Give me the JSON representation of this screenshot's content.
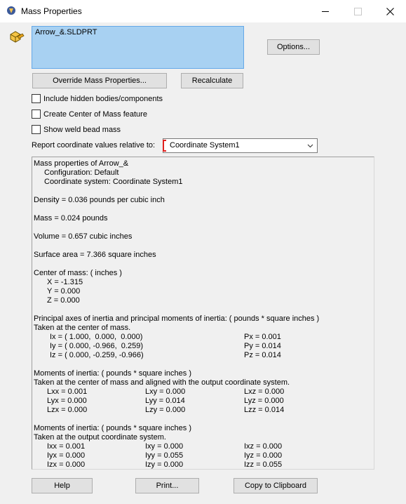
{
  "window": {
    "title": "Mass Properties"
  },
  "selection": {
    "item": "Arrow_&.SLDPRT"
  },
  "buttons": {
    "options": "Options...",
    "override": "Override Mass Properties...",
    "recalculate": "Recalculate",
    "help": "Help",
    "print": "Print...",
    "copy": "Copy to Clipboard"
  },
  "checkboxes": [
    {
      "label": "Include hidden bodies/components",
      "checked": false
    },
    {
      "label": "Create Center of Mass feature",
      "checked": false
    },
    {
      "label": "Show weld bead mass",
      "checked": false
    }
  ],
  "report": {
    "label": "Report coordinate values relative to:",
    "selected": "Coordinate System1"
  },
  "results": {
    "header": "Mass properties of Arrow_&",
    "configuration": "Configuration: Default",
    "coord_system": "Coordinate system: Coordinate System1",
    "density": "Density = 0.036 pounds per cubic inch",
    "mass": "Mass = 0.024 pounds",
    "volume": "Volume = 0.657 cubic inches",
    "surface_area": "Surface area = 7.366 square inches",
    "com_title": "Center of mass: ( inches )",
    "com": [
      "X = -1.315",
      "Y = 0.000",
      "Z = 0.000"
    ],
    "principal_title": "Principal axes of inertia and principal moments of inertia: ( pounds * square inches )",
    "principal_sub": "Taken at the center of mass.",
    "principal_axes": [
      "Ix = ( 1.000,  0.000,  0.000)",
      "Iy = ( 0.000, -0.966,  0.259)",
      "Iz = ( 0.000, -0.259, -0.966)"
    ],
    "principal_moments": [
      "Px = 0.001",
      "Py = 0.014",
      "Pz = 0.014"
    ],
    "moi_com_title": "Moments of inertia: ( pounds * square inches )",
    "moi_com_sub": "Taken at the center of mass and aligned with the output coordinate system.",
    "moi_com": [
      [
        "Lxx = 0.001",
        "Lxy = 0.000",
        "Lxz = 0.000"
      ],
      [
        "Lyx = 0.000",
        "Lyy = 0.014",
        "Lyz = 0.000"
      ],
      [
        "Lzx = 0.000",
        "Lzy = 0.000",
        "Lzz = 0.014"
      ]
    ],
    "moi_out_title": "Moments of inertia: ( pounds * square inches )",
    "moi_out_sub": "Taken at the output coordinate system.",
    "moi_out": [
      [
        "Ixx = 0.001",
        "Ixy = 0.000",
        "Ixz = 0.000"
      ],
      [
        "Iyx = 0.000",
        "Iyy = 0.055",
        "Iyz = 0.000"
      ],
      [
        "Izx = 0.000",
        "Izy = 0.000",
        "Izz = 0.055"
      ]
    ]
  }
}
